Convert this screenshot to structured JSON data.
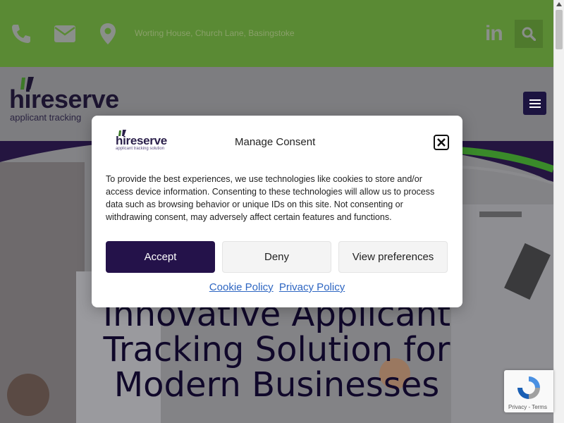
{
  "topbar": {
    "address": "Worting House, Church Lane, Basingstoke",
    "icons": [
      "phone-icon",
      "envelope-icon",
      "map-marker-icon",
      "linkedin-icon",
      "search-icon"
    ],
    "linkedin_text": "in",
    "color": "#5a8a34"
  },
  "header": {
    "logo_word": "hireserve",
    "logo_tagline": "applicant tracking"
  },
  "hero": {
    "title": "Innovative Applicant Tracking Solution for Modern Businesses"
  },
  "modal": {
    "logo_word": "hireserve",
    "logo_tagline": "applicant tracking solution",
    "title": "Manage Consent",
    "body": "To provide the best experiences, we use technologies like cookies to store and/or access device information. Consenting to these technologies will allow us to process data such as browsing behavior or unique IDs on this site. Not consenting or withdrawing consent, may adversely affect certain features and functions.",
    "accept_label": "Accept",
    "deny_label": "Deny",
    "prefs_label": "View preferences",
    "cookie_policy_label": "Cookie Policy",
    "privacy_policy_label": "Privacy Policy",
    "accent": "#24124a"
  },
  "recaptcha": {
    "text": "Privacy - Terms"
  }
}
